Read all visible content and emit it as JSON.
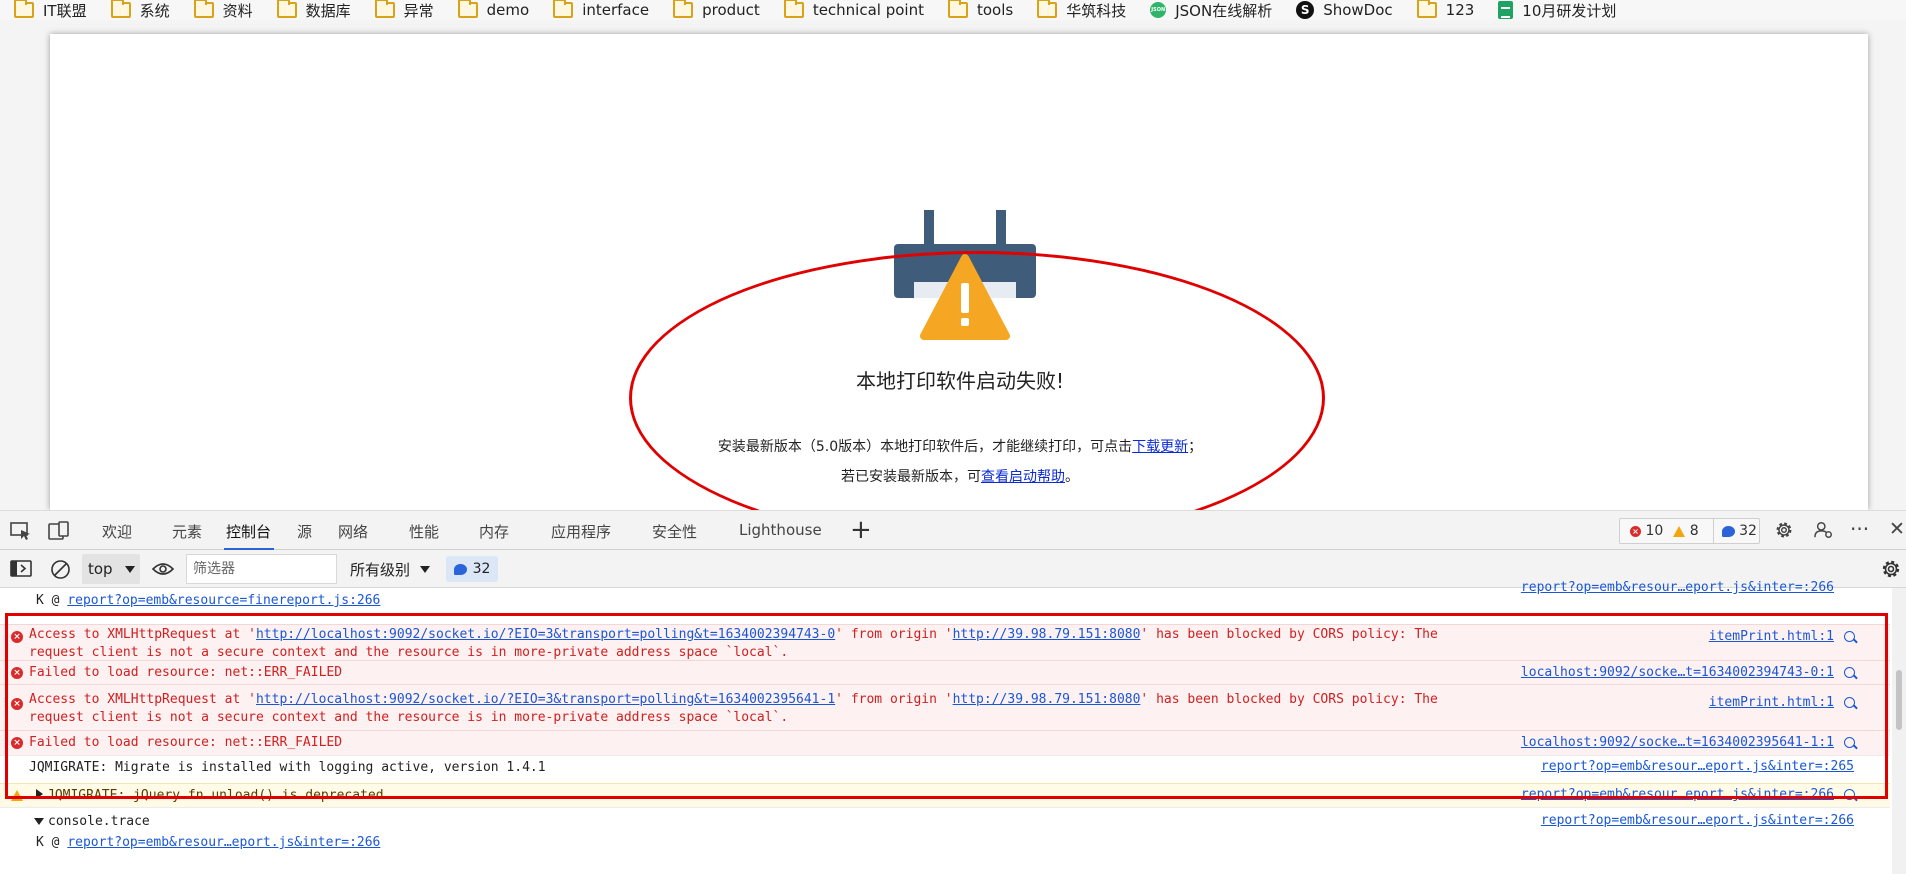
{
  "bookmarks": [
    {
      "label": "IT联盟",
      "icon": "folder-icon"
    },
    {
      "label": "系统",
      "icon": "folder-icon"
    },
    {
      "label": "资料",
      "icon": "folder-icon"
    },
    {
      "label": "数据库",
      "icon": "folder-icon"
    },
    {
      "label": "异常",
      "icon": "folder-icon"
    },
    {
      "label": "demo",
      "icon": "folder-icon"
    },
    {
      "label": "interface",
      "icon": "folder-icon"
    },
    {
      "label": "product",
      "icon": "folder-icon"
    },
    {
      "label": "technical point",
      "icon": "folder-icon"
    },
    {
      "label": "tools",
      "icon": "folder-icon"
    },
    {
      "label": "华筑科技",
      "icon": "folder-icon"
    },
    {
      "label": "JSON在线解析",
      "icon": "json-icon"
    },
    {
      "label": "ShowDoc",
      "icon": "showdoc-icon"
    },
    {
      "label": "123",
      "icon": "folder-icon"
    },
    {
      "label": "10月研发计划",
      "icon": "sheet-icon"
    }
  ],
  "page": {
    "icon_text": "JSON",
    "sd_icon_text": "S",
    "title": "本地打印软件启动失败!",
    "line1_prefix": "安装最新版本（5.0版本）本地打印软件后，才能继续打印，可点击",
    "line1_link": "下载更新",
    "line1_suffix": "；",
    "line2_prefix": "若已安装最新版本，可",
    "line2_link": "查看启动帮助",
    "line2_suffix": "。",
    "accent_red": "#e00000",
    "link_color": "#0b2bd6"
  },
  "devtools": {
    "tabs": [
      "欢迎",
      "元素",
      "控制台",
      "源",
      "网络",
      "性能",
      "内存",
      "应用程序",
      "安全性",
      "Lighthouse"
    ],
    "active_tab": "控制台",
    "add_tab": "+",
    "error_count": "10",
    "warning_count": "8",
    "info_count": "32",
    "more": "···",
    "close": "✕",
    "error_mark": "×"
  },
  "toolbar": {
    "context": "top",
    "filter_placeholder": "筛选器",
    "levels": "所有级别",
    "message_count": "32"
  },
  "console": {
    "top_partial_src": "report?op=emb&resour…eport.js&inter=:266",
    "top_partial_link": "report?op=emb&resource=finereport.js:266",
    "top_partial_prefix": "K @ ",
    "err1_a": "Access to XMLHttpRequest at '",
    "err1_link1": "http://localhost:9092/socket.io/?EIO=3&transport=polling&t=1634002394743-0",
    "err1_b": "' from origin '",
    "err1_link2": "http://39.98.79.151:8080",
    "err1_c": "' has been blocked by CORS policy: The request client is not a secure context and the resource is in more-private address space `local`.",
    "err1_src": "itemPrint.html:1",
    "err2_text": "Failed to load resource: net::ERR_FAILED",
    "err2_src": "localhost:9092/socke…t=1634002394743-0:1",
    "err3_a": "Access to XMLHttpRequest at '",
    "err3_link1": "http://localhost:9092/socket.io/?EIO=3&transport=polling&t=1634002395641-1",
    "err3_b": "' from origin '",
    "err3_link2": "http://39.98.79.151:8080",
    "err3_c": "' has been blocked by CORS policy: The request client is not a secure context and the resource is in more-private address space `local`.",
    "err3_src": "itemPrint.html:1",
    "err4_text": "Failed to load resource: net::ERR_FAILED",
    "err4_src": "localhost:9092/socke…t=1634002395641-1:1",
    "info1_text": "JQMIGRATE: Migrate is installed with logging active, version 1.4.1",
    "info1_src": "report?op=emb&resour…eport.js&inter=:265",
    "warn1_text": "JQMIGRATE: jQuery.fn.unload() is deprecated",
    "warn1_src": "report?op=emb&resour…eport.js&inter=:266",
    "trace_text": "console.trace",
    "trace_src": "report?op=emb&resour…eport.js&inter=:266",
    "trace_prefix": "K @ ",
    "trace_link": "report?op=emb&resour…eport.js&inter=:266"
  }
}
